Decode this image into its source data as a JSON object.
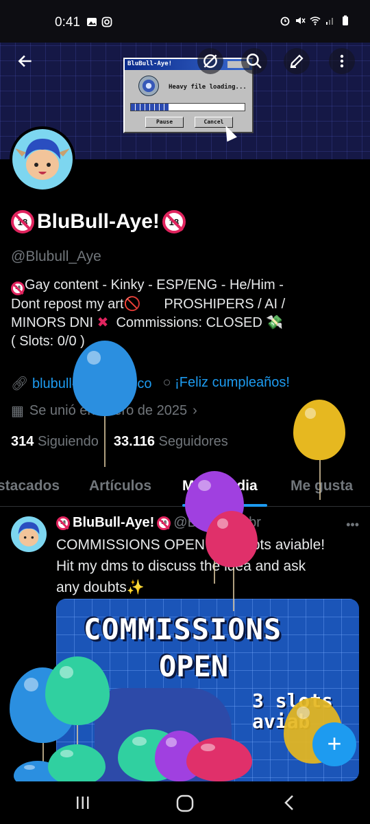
{
  "status_bar": {
    "time": "0:41",
    "left_icons": [
      "gallery-icon",
      "instagram-icon"
    ],
    "right_icons": [
      "alarm-icon",
      "mute-icon",
      "wifi-icon",
      "signal-icon",
      "battery-icon"
    ]
  },
  "banner": {
    "window_title": "BluBull-Aye!",
    "message": "Heavy file loading...",
    "pause_label": "Pause",
    "cancel_label": "Cancel",
    "progress": 0.33
  },
  "top_actions": [
    "back-arrow-icon",
    "grok-icon",
    "search-icon",
    "edit-icon",
    "more-vertical-icon"
  ],
  "profile": {
    "name": "BluBull-Aye!",
    "name_badge": "18",
    "handle": "@Blubull_Aye",
    "bio_line1": "Gay content - Kinky - ESP/ENG - He/Him -",
    "bio_line2": "Dont repost my art",
    "bio_line2b": "PROSHIPERS / AI /",
    "bio_line3a": "MINORS DNI",
    "bio_line3b": "Commissions: CLOSED",
    "bio_line4": "( Slots: 0/0 )",
    "website": "blubull-aye.carrd.co",
    "birthday": "¡Feliz cumpleaños!",
    "joined": "Se unió en enero de 2025",
    "following_count": "314",
    "following_label": "Siguiendo",
    "followers_count": "33.116",
    "followers_label": "Seguidores"
  },
  "tabs": [
    {
      "label": "stacados"
    },
    {
      "label": "Artículos"
    },
    {
      "label": "Multimedia"
    },
    {
      "label": "Me gusta"
    }
  ],
  "post": {
    "author": "BluBull-Aye!",
    "handle": "@Bl...",
    "date": "· 02 abr",
    "text_line1": "COMMISSIONS OPEN - 3/3 slots aviable!",
    "text_line2": "Hit my dms to discuss the idea and ask",
    "text_line3": "any doubts✨",
    "image_title1": "COMMISSIONS",
    "image_title2": "OPEN",
    "image_slots1": "3 slots",
    "image_slots2": "aviab"
  },
  "fab_label": "+",
  "colors": {
    "accent": "#1d9bf0",
    "muted": "#71767b",
    "badge_red": "#e0245e",
    "balloon_blue": "#2b8fe0",
    "balloon_yellow": "#e6b820",
    "balloon_purple": "#a040e0",
    "balloon_pink": "#e0306a",
    "balloon_green": "#30d0a0"
  }
}
